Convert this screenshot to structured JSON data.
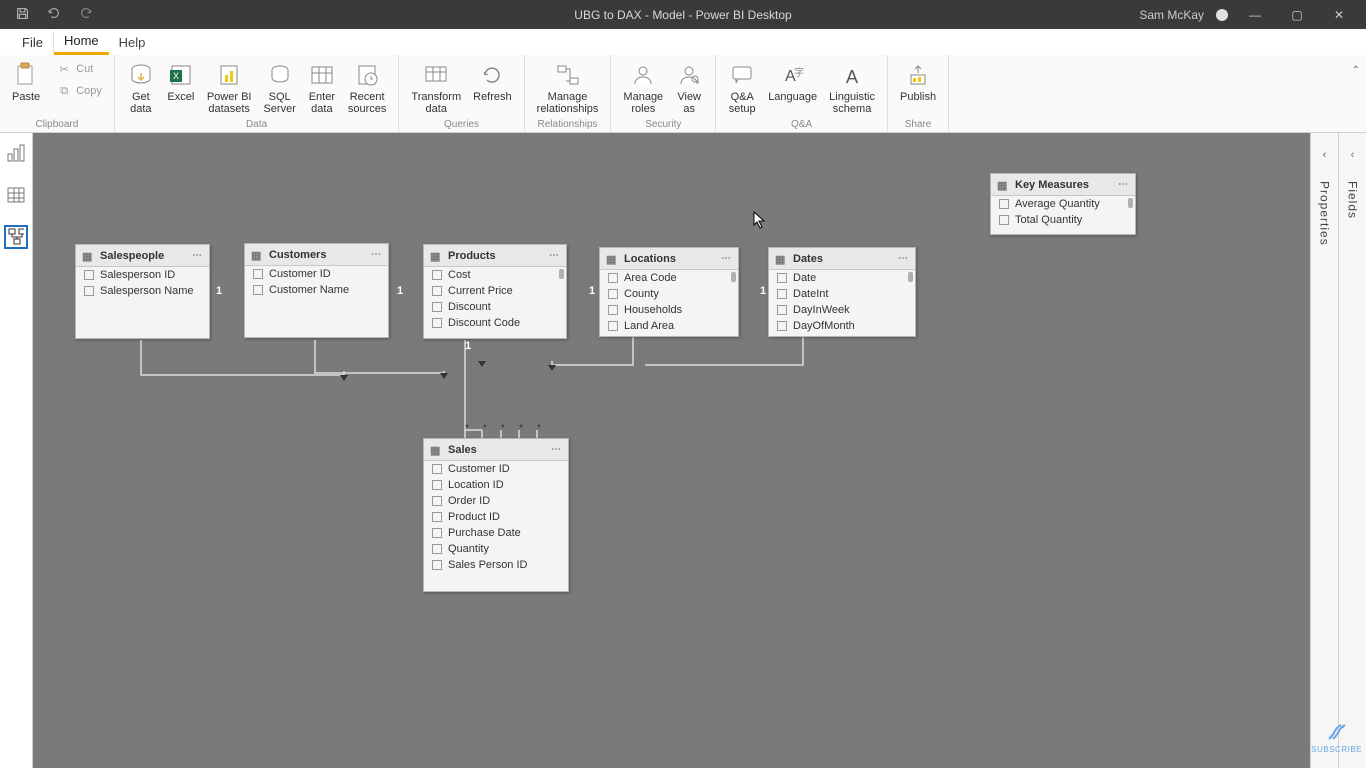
{
  "titlebar": {
    "title": "UBG to DAX - Model - Power BI Desktop",
    "user": "Sam McKay"
  },
  "menu": {
    "file": "File",
    "home": "Home",
    "help": "Help"
  },
  "ribbon": {
    "clipboard": {
      "paste": "Paste",
      "cut": "Cut",
      "copy": "Copy",
      "label": "Clipboard"
    },
    "data": {
      "get_data": "Get\ndata",
      "excel": "Excel",
      "pbi_datasets": "Power BI\ndatasets",
      "sql": "SQL\nServer",
      "enter_data": "Enter\ndata",
      "recent_sources": "Recent\nsources",
      "label": "Data"
    },
    "queries": {
      "transform": "Transform\ndata",
      "refresh": "Refresh",
      "label": "Queries"
    },
    "relationships": {
      "manage": "Manage\nrelationships",
      "label": "Relationships"
    },
    "security": {
      "manage_roles": "Manage\nroles",
      "view_as": "View\nas",
      "label": "Security"
    },
    "qa": {
      "setup": "Q&A\nsetup",
      "language": "Language",
      "ling": "Linguistic\nschema",
      "label": "Q&A"
    },
    "share": {
      "publish": "Publish",
      "label": "Share"
    }
  },
  "panes": {
    "properties": "Properties",
    "fields": "Fields"
  },
  "tables": {
    "salespeople": {
      "title": "Salespeople",
      "fields": [
        "Salesperson ID",
        "Salesperson Name"
      ]
    },
    "customers": {
      "title": "Customers",
      "fields": [
        "Customer ID",
        "Customer Name"
      ]
    },
    "products": {
      "title": "Products",
      "fields": [
        "Cost",
        "Current Price",
        "Discount",
        "Discount Code"
      ]
    },
    "locations": {
      "title": "Locations",
      "fields": [
        "Area Code",
        "County",
        "Households",
        "Land Area"
      ]
    },
    "dates": {
      "title": "Dates",
      "fields": [
        "Date",
        "DateInt",
        "DayInWeek",
        "DayOfMonth"
      ]
    },
    "key_measures": {
      "title": "Key Measures",
      "fields": [
        "Average Quantity",
        "Total Quantity"
      ]
    },
    "sales": {
      "title": "Sales",
      "fields": [
        "Customer ID",
        "Location ID",
        "Order ID",
        "Product ID",
        "Purchase Date",
        "Quantity",
        "Sales Person ID"
      ]
    }
  },
  "watermark": "SUBSCRIBE"
}
